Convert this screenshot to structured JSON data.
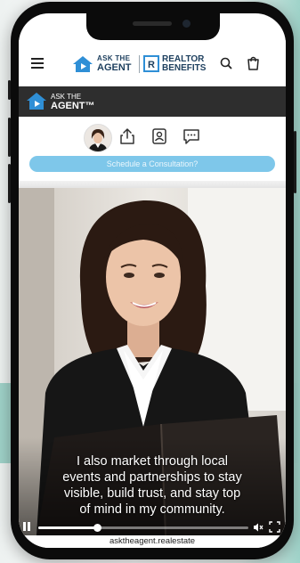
{
  "header": {
    "logo_line1": "ASK THE",
    "logo_line2": "AGENT",
    "partner_line1": "REALTOR",
    "partner_line2": "BENEFITS",
    "partner_mark": "®"
  },
  "agent_bar": {
    "logo_line1": "ASK THE",
    "logo_line2": "AGENT™"
  },
  "profile": {
    "schedule_label": "Schedule a Consultation?"
  },
  "video": {
    "subtitle_lines": [
      "I also market through local",
      "events and partnerships to stay",
      "visible, build trust, and stay top",
      "of mind in my community."
    ],
    "progress_fraction": 0.28
  },
  "footer": {
    "url": "asktheagent.realestate"
  },
  "icons": {
    "menu": "hamburger-icon",
    "search": "search-icon",
    "cart": "shopping-bag-icon",
    "share": "share-icon",
    "contact": "contact-card-icon",
    "chat": "chat-icon",
    "pause": "pause-icon",
    "mute": "mute-icon",
    "fullscreen": "fullscreen-icon"
  },
  "colors": {
    "brand_navy": "#1d3f5e",
    "brand_blue": "#2f8fd6",
    "schedule_button": "#7ec7ea",
    "agent_bar": "#2e2e2e"
  }
}
